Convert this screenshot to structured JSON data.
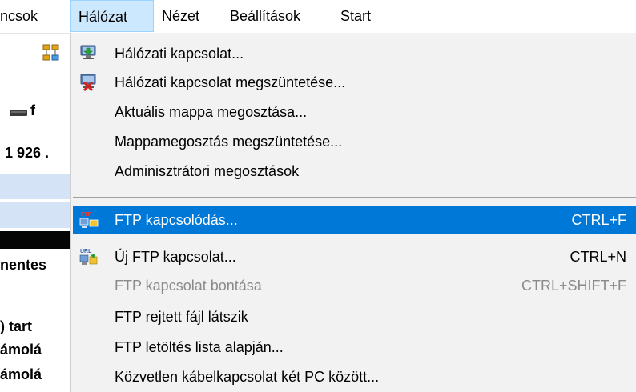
{
  "menubar": {
    "items": [
      "ncsok",
      "Hálózat",
      "Nézet",
      "Beállítások",
      "Start"
    ],
    "active_index": 1
  },
  "background": {
    "drive_label": "f",
    "number_text": "1 926 .",
    "text_rows": [
      "nentes",
      ") tart",
      "ámolá",
      "ámolá"
    ]
  },
  "dropdown": {
    "items": [
      {
        "label": "Hálózati kapcsolat...",
        "shortcut": "",
        "icon": "network-connect-icon",
        "state": "normal"
      },
      {
        "label": "Hálózati kapcsolat megszüntetése...",
        "shortcut": "",
        "icon": "network-disconnect-icon",
        "state": "normal"
      },
      {
        "label": "Aktuális mappa megosztása...",
        "shortcut": "",
        "icon": "",
        "state": "normal"
      },
      {
        "label": "Mappamegosztás megszüntetése...",
        "shortcut": "",
        "icon": "",
        "state": "normal"
      },
      {
        "label": "Adminisztrátori megosztások",
        "shortcut": "",
        "icon": "",
        "state": "normal"
      },
      {
        "label": "FTP kapcsolódás...",
        "shortcut": "CTRL+F",
        "icon": "ftp-connect-icon",
        "state": "highlighted"
      },
      {
        "label": "Új FTP kapcsolat...",
        "shortcut": "CTRL+N",
        "icon": "new-ftp-url-icon",
        "state": "normal"
      },
      {
        "label": "FTP kapcsolat bontása",
        "shortcut": "CTRL+SHIFT+F",
        "icon": "",
        "state": "disabled"
      },
      {
        "label": "FTP rejtett fájl látszik",
        "shortcut": "",
        "icon": "",
        "state": "normal"
      },
      {
        "label": "FTP letöltés lista alapján...",
        "shortcut": "",
        "icon": "",
        "state": "normal"
      },
      {
        "label": "Közvetlen kábelkapcsolat két PC között...",
        "shortcut": "",
        "icon": "",
        "state": "normal"
      }
    ]
  },
  "colors": {
    "highlight": "#0078d7",
    "menu_active_bg": "#cce8ff",
    "dropdown_bg": "#f2f2f2",
    "disabled_text": "#8a8a8a"
  }
}
